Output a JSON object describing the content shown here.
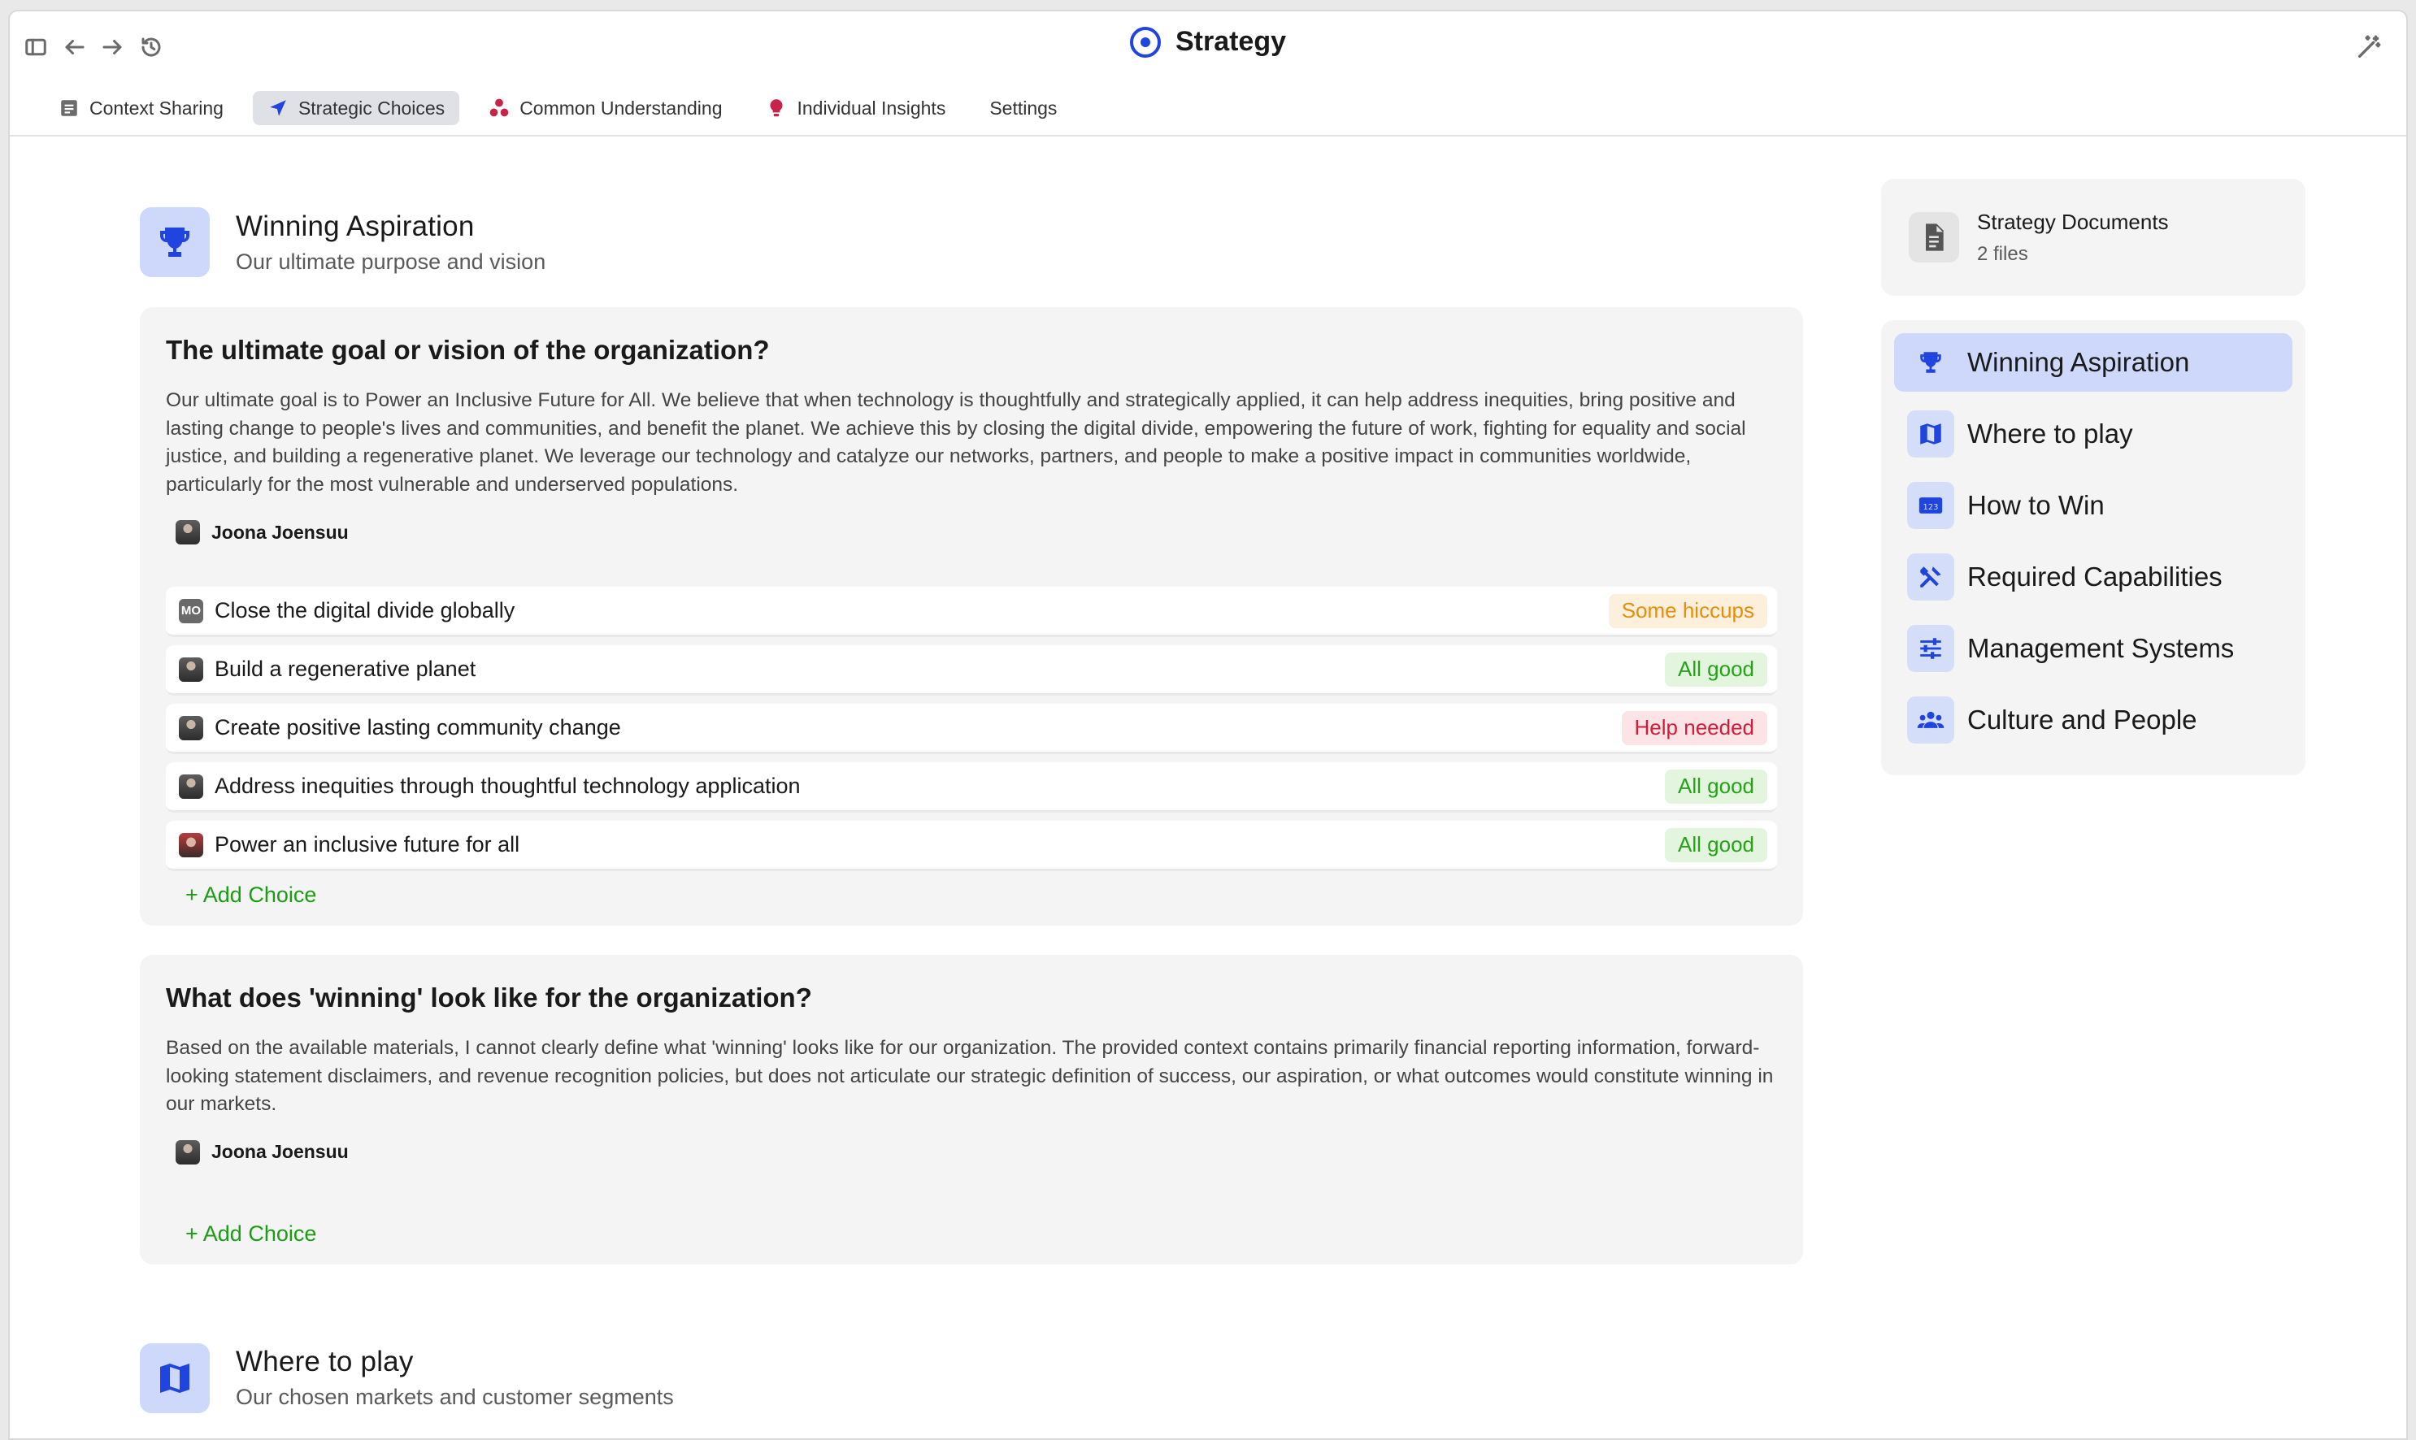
{
  "window": {
    "title": "Strategy"
  },
  "tabs": [
    {
      "label": "Context Sharing",
      "icon": "document-icon",
      "active": false
    },
    {
      "label": "Strategic Choices",
      "icon": "navigation-arrow-icon",
      "active": true
    },
    {
      "label": "Common Understanding",
      "icon": "cluster-dots-icon",
      "active": false
    },
    {
      "label": "Individual Insights",
      "icon": "lightbulb-icon",
      "active": false
    },
    {
      "label": "Settings",
      "icon": "",
      "active": false
    }
  ],
  "sections": [
    {
      "title": "Winning Aspiration",
      "subtitle": "Our ultimate purpose and vision",
      "icon": "trophy-icon",
      "cards": [
        {
          "question": "The ultimate goal or vision of the organization?",
          "answer": "Our ultimate goal is to Power an Inclusive Future for All. We believe that when technology is thoughtfully and strategically applied, it can help address inequities, bring positive and lasting change to people's lives and communities, and benefit the planet. We achieve this by closing the digital divide, empowering the future of work, fighting for equality and social justice, and building a regenerative planet. We leverage our technology and catalyze our networks, partners, and people to make a positive impact in communities worldwide, particularly for the most vulnerable and underserved populations.",
          "author": "Joona Joensuu",
          "choices": [
            {
              "avatar": "MO",
              "label": "Close the digital divide globally",
              "status": "Some hiccups",
              "status_type": "hiccups"
            },
            {
              "avatar": "",
              "label": "Build a regenerative planet",
              "status": "All good",
              "status_type": "good"
            },
            {
              "avatar": "",
              "label": "Create positive lasting community change",
              "status": "Help needed",
              "status_type": "help"
            },
            {
              "avatar": "",
              "label": "Address inequities through thoughtful technology application",
              "status": "All good",
              "status_type": "good"
            },
            {
              "avatar": "",
              "label": "Power an inclusive future for all",
              "status": "All good",
              "status_type": "good"
            }
          ],
          "add_choice": "+ Add Choice"
        },
        {
          "question": "What does 'winning' look like for the organization?",
          "answer": "Based on the available materials, I cannot clearly define what 'winning' looks like for our organization. The provided context contains primarily financial reporting information, forward-looking statement disclaimers, and revenue recognition policies, but does not articulate our strategic definition of success, our aspiration, or what outcomes would constitute winning in our markets.",
          "author": "Joona Joensuu",
          "add_choice": "+ Add Choice"
        }
      ]
    },
    {
      "title": "Where to play",
      "subtitle": "Our chosen markets and customer segments",
      "icon": "map-icon"
    }
  ],
  "documents": {
    "title": "Strategy Documents",
    "count": "2 files"
  },
  "nav": [
    {
      "label": "Winning Aspiration",
      "icon": "trophy-icon",
      "active": true
    },
    {
      "label": "Where to play",
      "icon": "map-icon",
      "active": false
    },
    {
      "label": "How to Win",
      "icon": "numbers-icon",
      "active": false
    },
    {
      "label": "Required Capabilities",
      "icon": "tools-icon",
      "active": false
    },
    {
      "label": "Management Systems",
      "icon": "sliders-icon",
      "active": false
    },
    {
      "label": "Culture and People",
      "icon": "people-icon",
      "active": false
    }
  ],
  "colors": {
    "accent": "#1f44e0",
    "accent_soft": "#cdd8fb",
    "status_good": "#24a317",
    "status_hiccups": "#e58e0c",
    "status_help": "#d11d3a",
    "add_choice": "#1a9e14"
  }
}
